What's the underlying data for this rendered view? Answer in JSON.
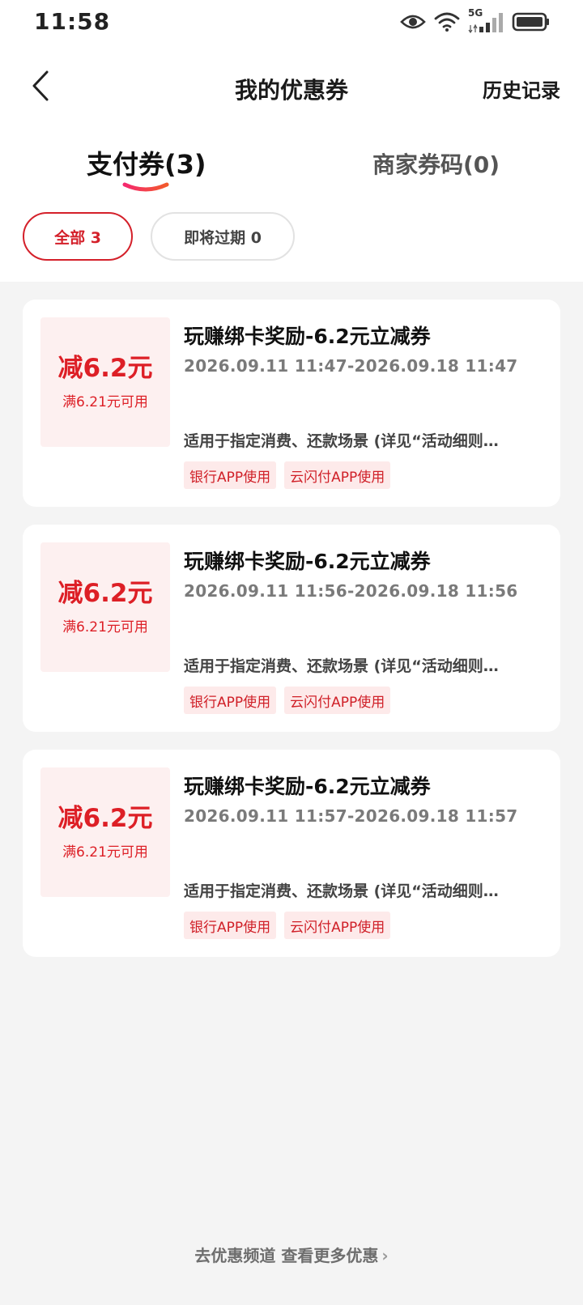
{
  "status_bar": {
    "time": "11:58",
    "icons": [
      "eye-icon",
      "wifi-icon",
      "cellular-5g-icon",
      "battery-icon"
    ],
    "network_label": "5G"
  },
  "header": {
    "title": "我的优惠券",
    "history_label": "历史记录"
  },
  "tabs": [
    {
      "label": "支付券(3)",
      "active": true
    },
    {
      "label": "商家券码(0)",
      "active": false
    }
  ],
  "filters": [
    {
      "label": "全部 3",
      "active": true
    },
    {
      "label": "即将过期 0",
      "active": false
    }
  ],
  "coupons": [
    {
      "amount": "减6.2元",
      "threshold": "满6.21元可用",
      "title": "玩赚绑卡奖励-6.2元立减券",
      "period": "2026.09.11 11:47-2026.09.18 11:47",
      "description": "适用于指定消费、还款场景 (详见“活动细则…",
      "tags": [
        "银行APP使用",
        "云闪付APP使用"
      ]
    },
    {
      "amount": "减6.2元",
      "threshold": "满6.21元可用",
      "title": "玩赚绑卡奖励-6.2元立减券",
      "period": "2026.09.11 11:56-2026.09.18 11:56",
      "description": "适用于指定消费、还款场景 (详见“活动细则…",
      "tags": [
        "银行APP使用",
        "云闪付APP使用"
      ]
    },
    {
      "amount": "减6.2元",
      "threshold": "满6.21元可用",
      "title": "玩赚绑卡奖励-6.2元立减券",
      "period": "2026.09.11 11:57-2026.09.18 11:57",
      "description": "适用于指定消费、还款场景 (详见“活动细则…",
      "tags": [
        "银行APP使用",
        "云闪付APP使用"
      ]
    }
  ],
  "footer": {
    "link_label": "去优惠频道 查看更多优惠",
    "chevron": "›"
  },
  "colors": {
    "accent_red": "#dd1f26",
    "coupon_box_bg": "#fdf0f0",
    "tag_bg": "#fdeaea",
    "page_bg": "#f4f4f4"
  }
}
